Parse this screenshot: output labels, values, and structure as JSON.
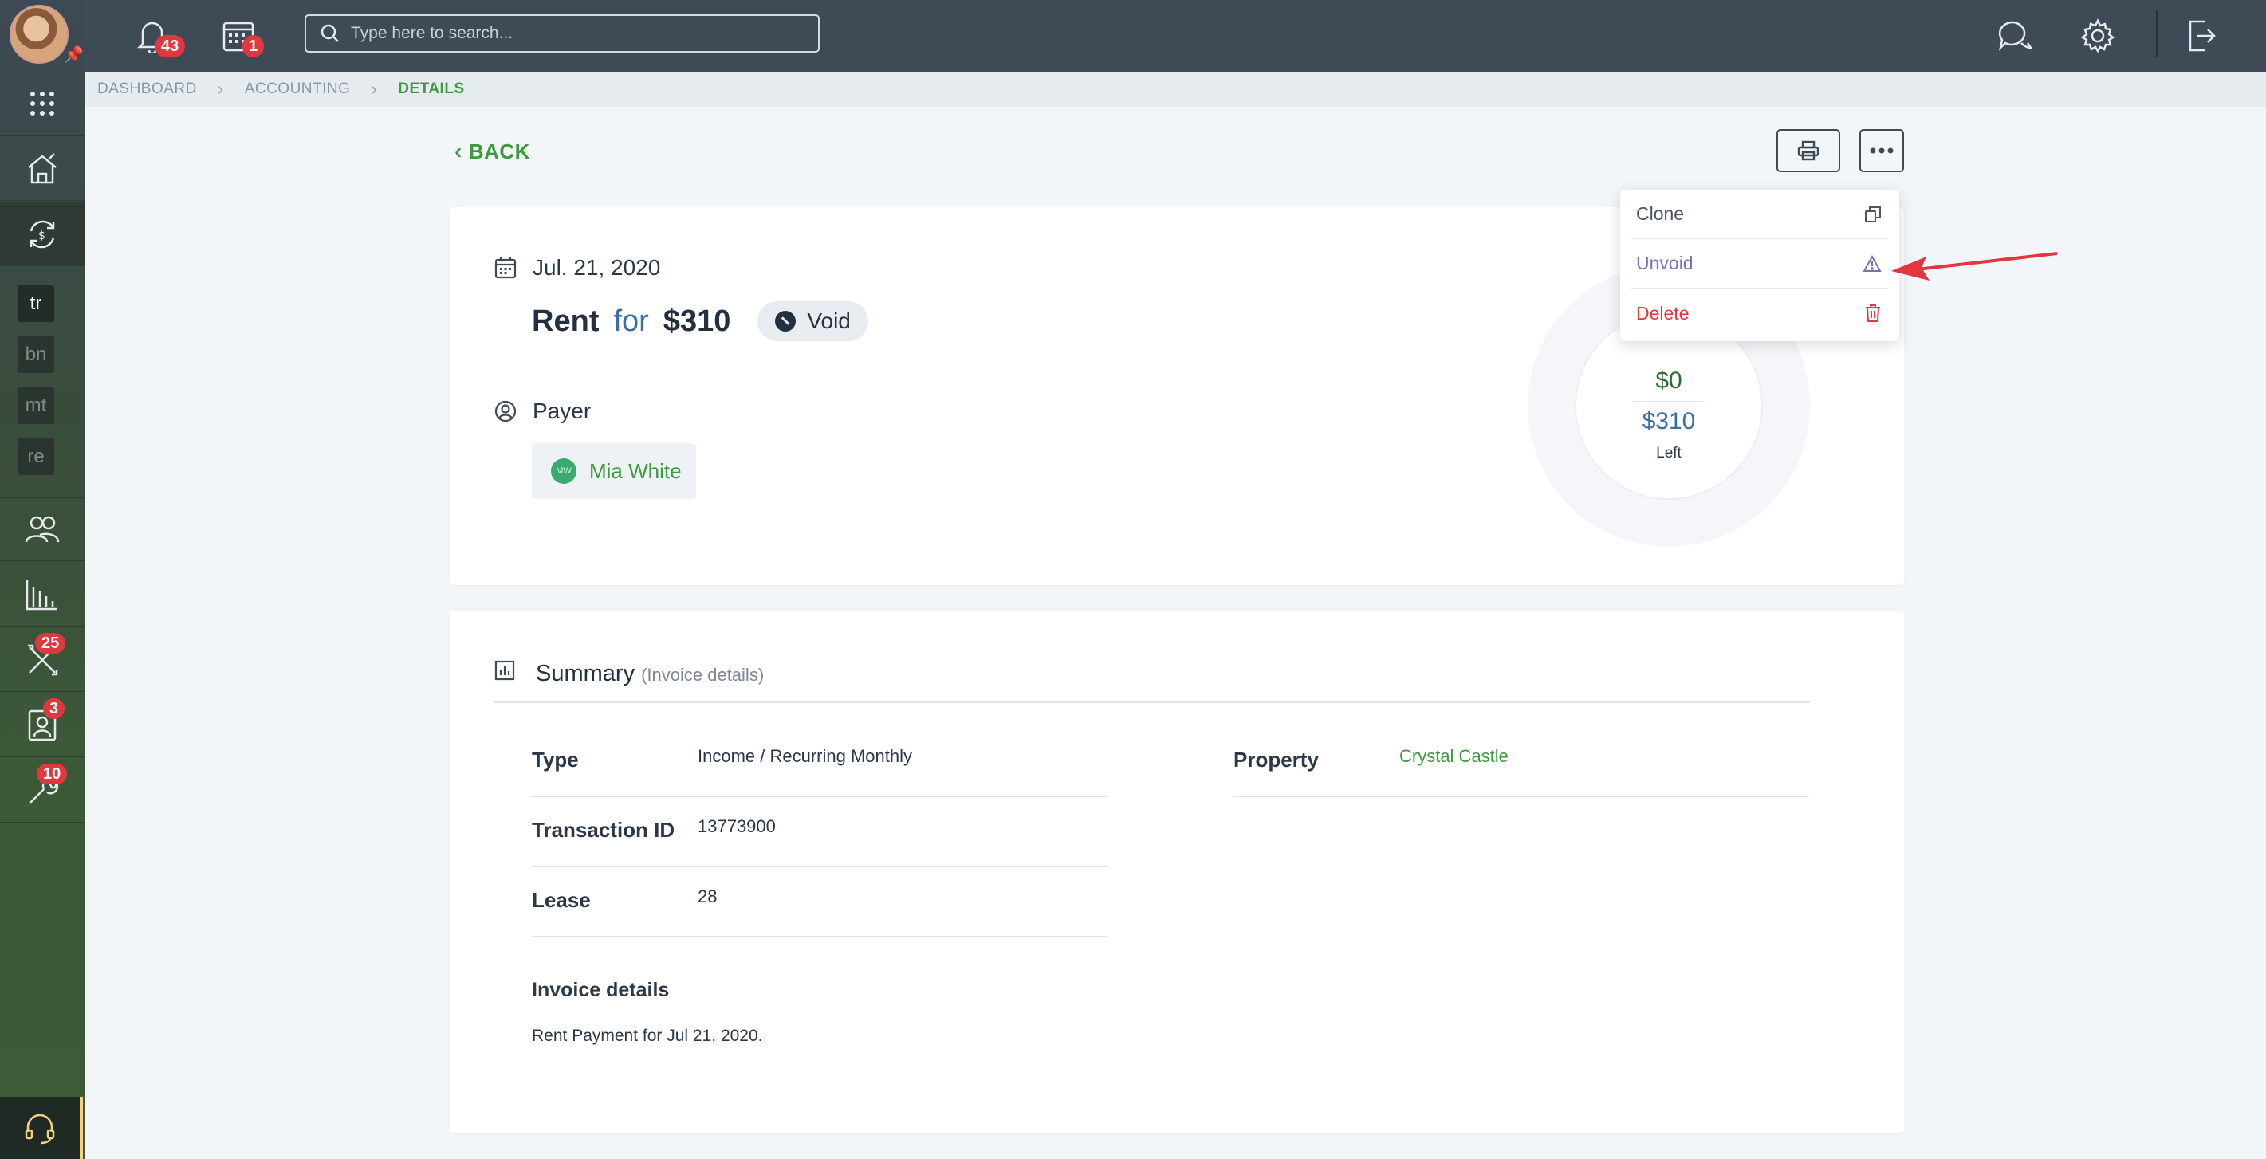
{
  "topbar": {
    "notifications_count": "43",
    "calendar_count": "1",
    "search_placeholder": "Type here to search..."
  },
  "sidebar": {
    "shortcuts": [
      {
        "label": "tr",
        "active": true
      },
      {
        "label": "bn",
        "active": false
      },
      {
        "label": "mt",
        "active": false
      },
      {
        "label": "re",
        "active": false
      }
    ],
    "badges": {
      "maintenance": "25",
      "contacts": "3",
      "tools": "10"
    }
  },
  "breadcrumb": {
    "items": [
      "DASHBOARD",
      "ACCOUNTING"
    ],
    "current": "DETAILS"
  },
  "page": {
    "back_label": "BACK"
  },
  "transaction": {
    "date": "Jul. 21, 2020",
    "category": "Rent",
    "for_word": "for",
    "amount": "$310",
    "status": "Void",
    "payer_label": "Payer",
    "payer_initials": "MW",
    "payer_name": "Mia White",
    "paid": "$0",
    "left": "$310",
    "left_label": "Left"
  },
  "menu": {
    "items": [
      {
        "label": "Clone",
        "icon": "copy-icon",
        "color": "#4a5664"
      },
      {
        "label": "Unvoid",
        "icon": "warning-triangle-icon",
        "color": "#7373b8"
      },
      {
        "label": "Delete",
        "icon": "trash-icon",
        "color": "#e0383e"
      }
    ]
  },
  "summary": {
    "title": "Summary",
    "subtitle": "(Invoice details)",
    "fields": {
      "type_label": "Type",
      "type_value": "Income / Recurring Monthly",
      "transaction_id_label": "Transaction ID",
      "transaction_id_value": "13773900",
      "lease_label": "Lease",
      "lease_value": "28",
      "property_label": "Property",
      "property_value": "Crystal Castle"
    },
    "invoice_details_label": "Invoice details",
    "invoice_details_text": "Rent Payment for Jul 21, 2020."
  },
  "colors": {
    "accent_green": "#3e9a3e",
    "link_blue": "#3a6ea5",
    "danger_red": "#e0383e",
    "topbar": "#3e4a56"
  }
}
